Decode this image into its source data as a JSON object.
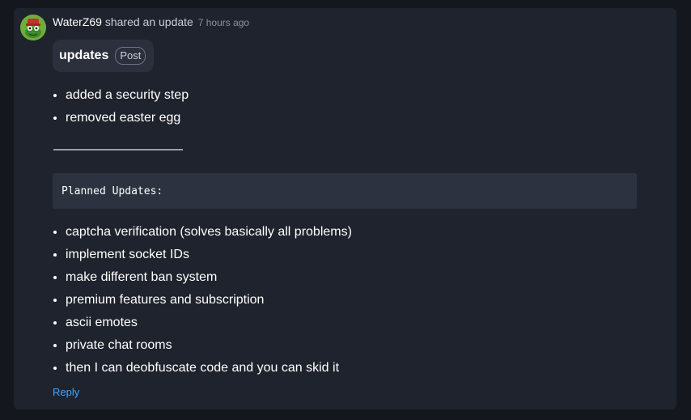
{
  "post": {
    "username": "WaterZ69",
    "action": "shared an update",
    "time": "7 hours ago",
    "title": "updates",
    "badge": "Post",
    "list1": [
      "added a security step",
      "removed easter egg"
    ],
    "divider": "——————————",
    "code": "Planned Updates:",
    "list2": [
      "captcha verification (solves basically all problems)",
      "implement socket IDs",
      "make different ban system",
      "premium features and subscription",
      "ascii emotes",
      "private chat rooms",
      "then I can deobfuscate code and you can skid it"
    ],
    "reply_label": "Reply"
  },
  "colors": {
    "page_bg": "#14171d",
    "card_bg": "#1f232d",
    "pill_bg": "#2b303c",
    "code_bg": "#2d3240",
    "link": "#4aa3ff",
    "avatar": "#7ab33c"
  },
  "icons": {
    "avatar": "avatar-frog-icon"
  }
}
